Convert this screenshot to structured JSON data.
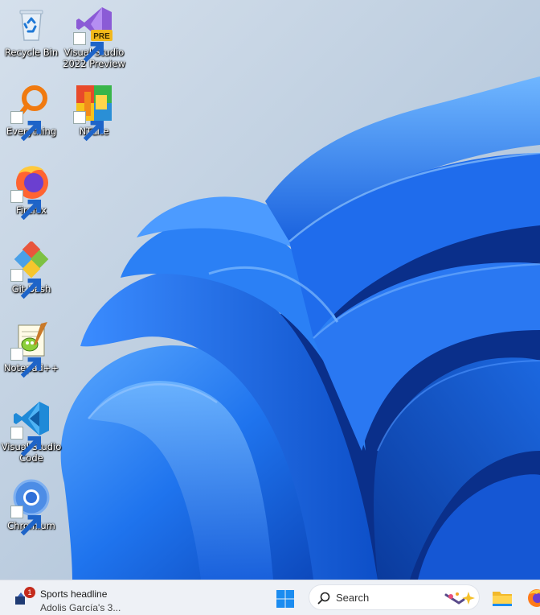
{
  "desktop": {
    "icons": [
      {
        "label": "Recycle Bin",
        "icon": "recycle-bin-icon",
        "shortcut": false
      },
      {
        "label": "Visual Studio\n2022 Preview",
        "icon": "visual-studio-preview-icon",
        "shortcut": true
      },
      {
        "label": "Everything",
        "icon": "everything-search-icon",
        "shortcut": true
      },
      {
        "label": "NTLite",
        "icon": "ntlite-icon",
        "shortcut": true
      },
      {
        "label": "Firefox",
        "icon": "firefox-icon",
        "shortcut": true
      },
      {
        "label": "Git Bash",
        "icon": "git-bash-icon",
        "shortcut": true
      },
      {
        "label": "Notepad++",
        "icon": "notepad-plus-plus-icon",
        "shortcut": true
      },
      {
        "label": "Visual Studio\nCode",
        "icon": "vscode-icon",
        "shortcut": true
      },
      {
        "label": "Chromium",
        "icon": "chromium-icon",
        "shortcut": true
      }
    ],
    "vs_badge": "PRE"
  },
  "taskbar": {
    "widget": {
      "title": "Sports headline",
      "subtitle": "Adolis García's 3...",
      "badge": "1",
      "icon": "news-widget-icon"
    },
    "start_icon": "windows-start-icon",
    "search": {
      "placeholder": "Search",
      "icon": "search-icon",
      "decoration_icon": "search-highlight-icon"
    },
    "pinned": [
      {
        "name": "File Explorer",
        "icon": "file-explorer-icon"
      },
      {
        "name": "Firefox",
        "icon": "firefox-icon"
      }
    ]
  },
  "colors": {
    "wallpaper_blue": "#1a6fe8",
    "wallpaper_dark": "#0a3ea8",
    "taskbar_bg": "#eef1f6",
    "badge_red": "#c42b1c"
  }
}
